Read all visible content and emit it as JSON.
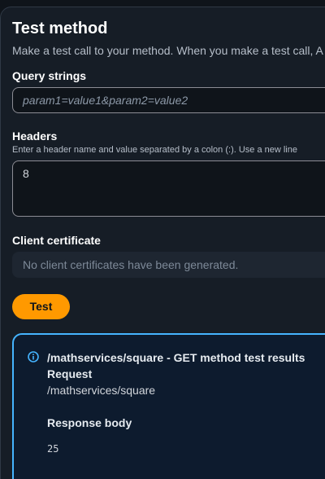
{
  "header": {
    "title": "Test method",
    "description": "Make a test call to your method. When you make a test call, A"
  },
  "query_strings": {
    "label": "Query strings",
    "placeholder": "param1=value1&param2=value2"
  },
  "headers": {
    "label": "Headers",
    "hint": "Enter a header name and value separated by a colon (:). Use a new line",
    "value": "8"
  },
  "client_certificate": {
    "label": "Client certificate",
    "placeholder": "No client certificates have been generated."
  },
  "test_button": {
    "label": "Test"
  },
  "results": {
    "icon": "info-icon",
    "title": "/mathservices/square - GET method test results",
    "request_label": "Request",
    "request_path": "/mathservices/square",
    "response_label": "Response body",
    "response_body": "25"
  },
  "colors": {
    "accent": "#ff9900",
    "info": "#45b4ff",
    "background": "#161d26"
  }
}
